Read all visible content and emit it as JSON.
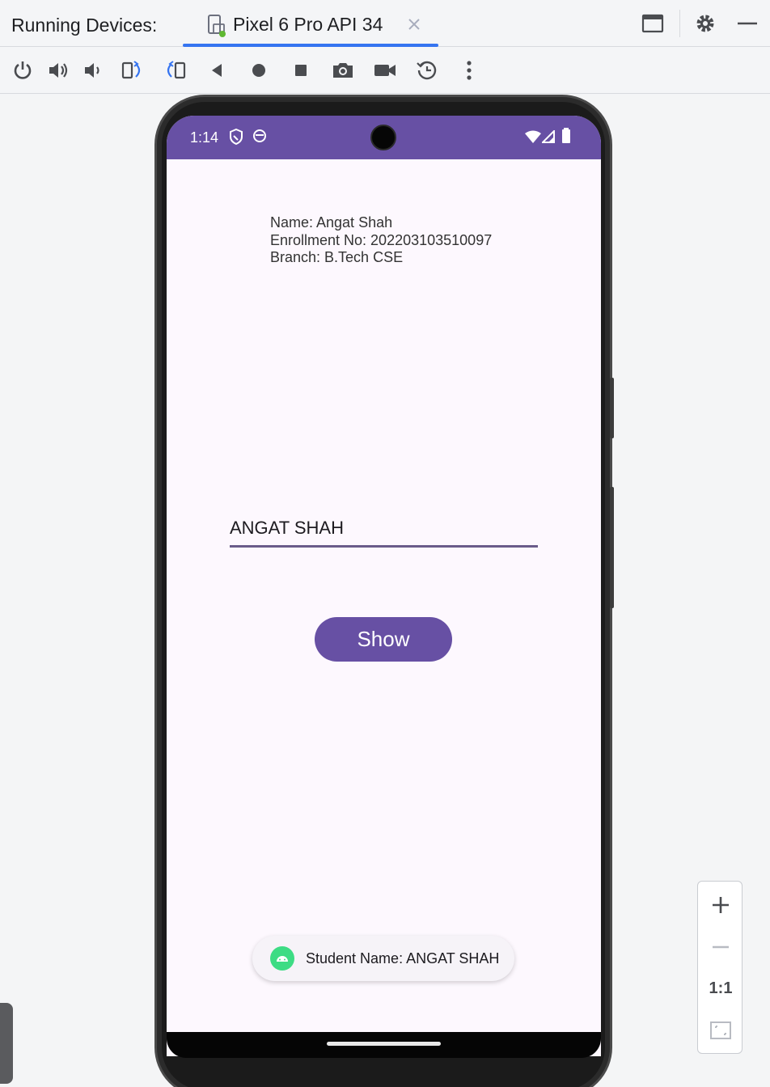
{
  "ide": {
    "panel_title": "Running Devices:",
    "tab_label": "Pixel 6 Pro API 34",
    "zoom_one_to_one": "1:1",
    "accent_color": "#3574f0"
  },
  "toolbar": {
    "tools": [
      "power-icon",
      "volume-up-icon",
      "volume-down-icon",
      "rotate-left-icon",
      "rotate-right-icon",
      "back-icon",
      "home-icon",
      "overview-icon",
      "screenshot-icon",
      "screen-record-icon",
      "snapshot-reset-icon",
      "more-options-icon"
    ]
  },
  "device": {
    "status_time": "1:14",
    "status_color": "#6750a4",
    "info_lines": [
      "Name: Angat Shah",
      "Enrollment No: 202203103510097",
      "Branch: B.Tech CSE"
    ],
    "name_input_value": "ANGAT SHAH",
    "show_button_label": "Show",
    "toast_text": "Student Name: ANGAT SHAH"
  }
}
